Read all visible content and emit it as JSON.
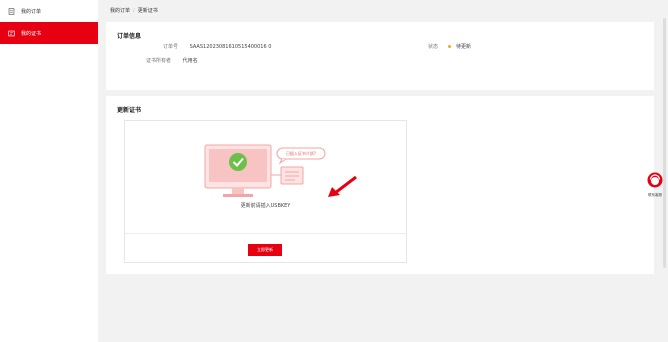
{
  "sidebar": {
    "items": [
      {
        "label": "我的订单",
        "icon": "order-icon",
        "active": false
      },
      {
        "label": "我的证书",
        "icon": "certificate-icon",
        "active": true
      }
    ]
  },
  "breadcrumb": {
    "items": [
      "我的订单",
      "更新证书"
    ]
  },
  "order_info": {
    "title": "订单信息",
    "order_no_label": "订单号",
    "order_no": "SAAS12023081610515400016 0",
    "holder_label": "证书所有者",
    "holder": "代用名",
    "status_label": "状态",
    "status": "待更新",
    "status_color": "#f5a623"
  },
  "renew": {
    "title": "更新证书",
    "bubble_text": "已插入证书介质?",
    "caption": "更新前请插入USBKEY",
    "button_label": "立即更新"
  },
  "support": {
    "label": "联系客服",
    "icon": "customer-service-icon"
  },
  "colors": {
    "accent": "#e60012",
    "page_bg": "#f2f2f2"
  }
}
